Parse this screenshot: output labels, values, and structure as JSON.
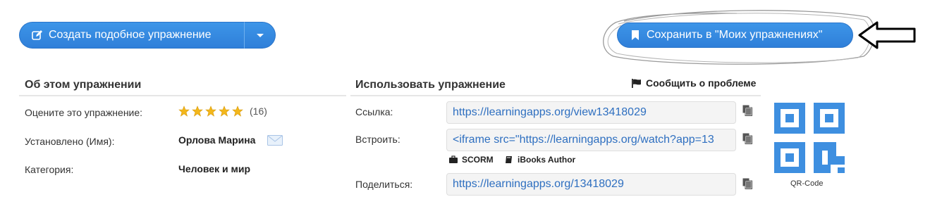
{
  "toolbar": {
    "create_similar_label": "Создать подобное упражнение",
    "save_label": "Сохранить в \"Моих упражнениях\""
  },
  "about": {
    "title": "Об этом упражнении",
    "rate_label": "Оцените это упражнение:",
    "rating_count": "(16)",
    "rating_stars": 5,
    "author_label": "Установлено (Имя):",
    "author_value": "Орлова Марина",
    "category_label": "Категория:",
    "category_value": "Человек и мир"
  },
  "use": {
    "title": "Использовать упражнение",
    "report_label": "Сообщить о проблеме",
    "link_label": "Ссылка:",
    "link_value": "https://learningapps.org/view13418029",
    "embed_label": "Встроить:",
    "embed_value": "<iframe src=\"https://learningapps.org/watch?app=13",
    "scorm_label": "SCORM",
    "ibooks_label": "iBooks Author",
    "share_label": "Поделиться:",
    "share_value": "https://learningapps.org/13418029",
    "qr_label": "QR-Code"
  },
  "colors": {
    "accent": "#2f7fd9",
    "link": "#2e6fc0",
    "star": "#f0b400",
    "qr": "#3e8fe0"
  }
}
